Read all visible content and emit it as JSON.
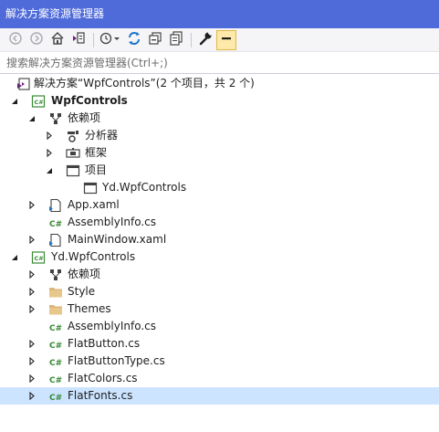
{
  "window": {
    "title": "解决方案资源管理器"
  },
  "toolbar": {
    "icons": [
      "back-icon",
      "forward-icon",
      "home-icon",
      "switch-views-icon",
      "pending-changes-icon",
      "sync-icon",
      "collapse-all-icon",
      "show-all-files-icon",
      "properties-icon",
      "preview-icon"
    ]
  },
  "search": {
    "placeholder": "搜索解决方案资源管理器(Ctrl+;)"
  },
  "tree": {
    "solution": "解决方案“WpfControls”(2 个项目，共 2 个)",
    "project1": {
      "name": "WpfControls",
      "dependencies": "依赖项",
      "analyzers": "分析器",
      "frameworks": "框架",
      "projects": "项目",
      "project_ref": "Yd.WpfControls",
      "app": "App.xaml",
      "assemblyinfo": "AssemblyInfo.cs",
      "mainwindow": "MainWindow.xaml"
    },
    "project2": {
      "name": "Yd.WpfControls",
      "dependencies": "依赖项",
      "style": "Style",
      "themes": "Themes",
      "assemblyinfo": "AssemblyInfo.cs",
      "flatbutton": "FlatButton.cs",
      "flatbuttontype": "FlatButtonType.cs",
      "flatcolors": "FlatColors.cs",
      "flatfonts": "FlatFonts.cs"
    }
  },
  "colors": {
    "title_bg": "#4f6bda",
    "selected_row": "#cce4ff",
    "csharp_green": "#388a34",
    "folder_tan": "#dcb67a",
    "vs_purple": "#68217a"
  }
}
